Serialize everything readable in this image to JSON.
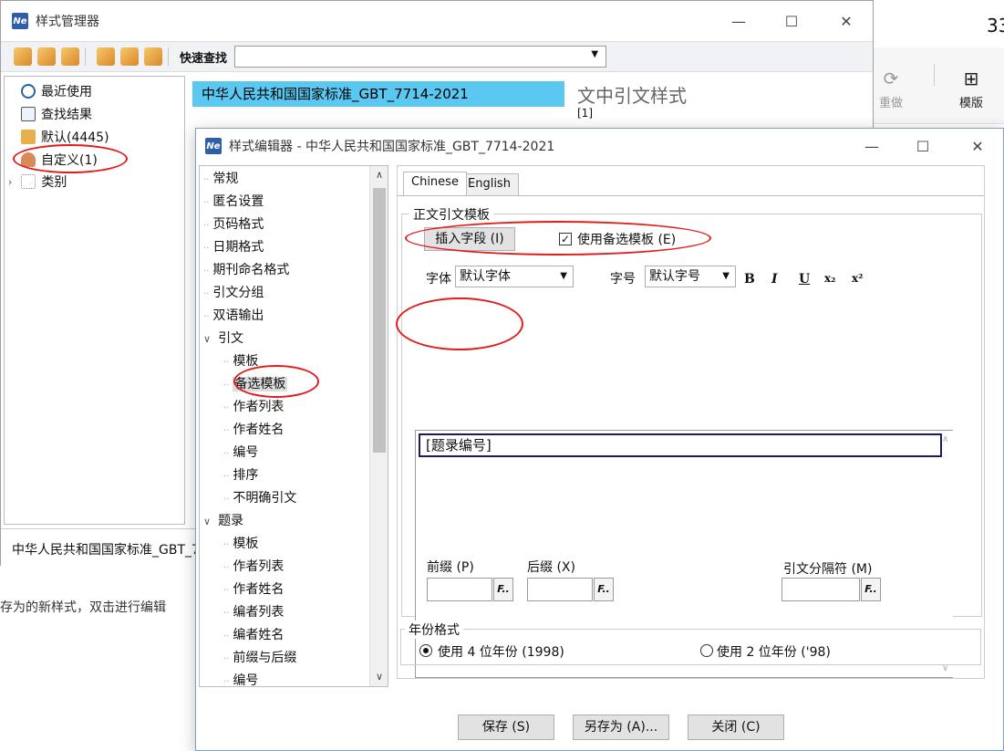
{
  "background_app": {
    "page_number": "33",
    "redo_label": "重做",
    "template_label": "模版"
  },
  "manager": {
    "title": "样式管理器",
    "quick_search_label": "快速查找",
    "quick_search_value": "",
    "tree": [
      {
        "label": "最近使用",
        "icon": "clock-icon"
      },
      {
        "label": "查找结果",
        "icon": "search-icon"
      },
      {
        "label": "默认(4445)",
        "icon": "folder-icon"
      },
      {
        "label": "自定义(1)",
        "icon": "user-icon"
      },
      {
        "label": "类别",
        "icon": "category-icon"
      }
    ],
    "selected_style": "中华人民共和国国家标准_GBT_7714-2021",
    "preview_title": "文中引文样式",
    "preview_sample": "[1]",
    "status_text": "中华人民共和国国家标准_GBT_7714-2021",
    "behind_text": "存为的新样式，双击进行编辑"
  },
  "editor": {
    "title": "样式编辑器 - 中华人民共和国国家标准_GBT_7714-2021",
    "tree": [
      {
        "label": "常规",
        "level": 0
      },
      {
        "label": "匿名设置",
        "level": 0
      },
      {
        "label": "页码格式",
        "level": 0
      },
      {
        "label": "日期格式",
        "level": 0
      },
      {
        "label": "期刊命名格式",
        "level": 0
      },
      {
        "label": "引文分组",
        "level": 0
      },
      {
        "label": "双语输出",
        "level": 0
      },
      {
        "label": "引文",
        "level": 0,
        "expanded": true
      },
      {
        "label": "模板",
        "level": 1
      },
      {
        "label": "备选模板",
        "level": 1,
        "selected": true
      },
      {
        "label": "作者列表",
        "level": 1
      },
      {
        "label": "作者姓名",
        "level": 1
      },
      {
        "label": "编号",
        "level": 1
      },
      {
        "label": "排序",
        "level": 1
      },
      {
        "label": "不明确引文",
        "level": 1
      },
      {
        "label": "题录",
        "level": 0,
        "expanded": true
      },
      {
        "label": "模板",
        "level": 1
      },
      {
        "label": "作者列表",
        "level": 1
      },
      {
        "label": "作者姓名",
        "level": 1
      },
      {
        "label": "编者列表",
        "level": 1
      },
      {
        "label": "编者姓名",
        "level": 1
      },
      {
        "label": "前缀与后缀",
        "level": 1
      },
      {
        "label": "编号",
        "level": 1
      }
    ],
    "tabs": [
      "Chinese",
      "English"
    ],
    "active_tab": "Chinese",
    "group_label": "正文引文模板",
    "insert_field_button": "插入字段 (I)",
    "use_alt_template_label": "使用备选模板 (E)",
    "use_alt_template_checked": true,
    "font_label": "字体",
    "font_value": "默认字体",
    "size_label": "字号",
    "size_value": "默认字号",
    "format_buttons": [
      "B",
      "I",
      "U",
      "x₂",
      "x²"
    ],
    "template_text": "[题录编号]",
    "prefix_label": "前缀 (P)",
    "suffix_label": "后缀 (X)",
    "separator_label": "引文分隔符 (M)",
    "f_button": "F..",
    "year_group_label": "年份格式",
    "year_4_label": "使用 4 位年份 (1998)",
    "year_2_label": "使用 2 位年份 ('98)",
    "year_selected": "4",
    "save_button": "保存 (S)",
    "save_as_button": "另存为 (A)...",
    "close_button": "关闭 (C)"
  },
  "colors": {
    "selection": "#5ac8f0",
    "annotation": "#e21b1b",
    "app_icon": "#2d5fa8"
  }
}
